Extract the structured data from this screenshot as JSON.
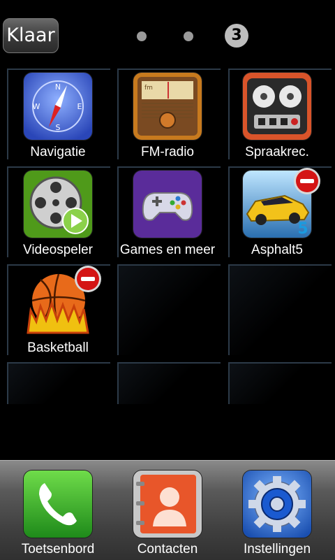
{
  "header": {
    "done_label": "Klaar",
    "current_page": "3"
  },
  "apps": [
    {
      "label": "Navigatie",
      "icon": "compass-icon"
    },
    {
      "label": "FM-radio",
      "icon": "radio-icon"
    },
    {
      "label": "Spraakrec.",
      "icon": "tape-recorder-icon"
    },
    {
      "label": "Videospeler",
      "icon": "film-reel-icon"
    },
    {
      "label": "Games en meer",
      "icon": "gamepad-icon"
    },
    {
      "label": "Asphalt5",
      "icon": "sports-car-icon",
      "removable": true
    },
    {
      "label": "Basketball",
      "icon": "basketball-icon",
      "removable": true
    }
  ],
  "dock": [
    {
      "label": "Toetsenbord",
      "icon": "phone-icon"
    },
    {
      "label": "Contacten",
      "icon": "contacts-book-icon"
    },
    {
      "label": "Instellingen",
      "icon": "settings-gear-icon"
    }
  ],
  "colors": {
    "remove_badge": "#d41414",
    "slot_border": "#2c3a48"
  }
}
